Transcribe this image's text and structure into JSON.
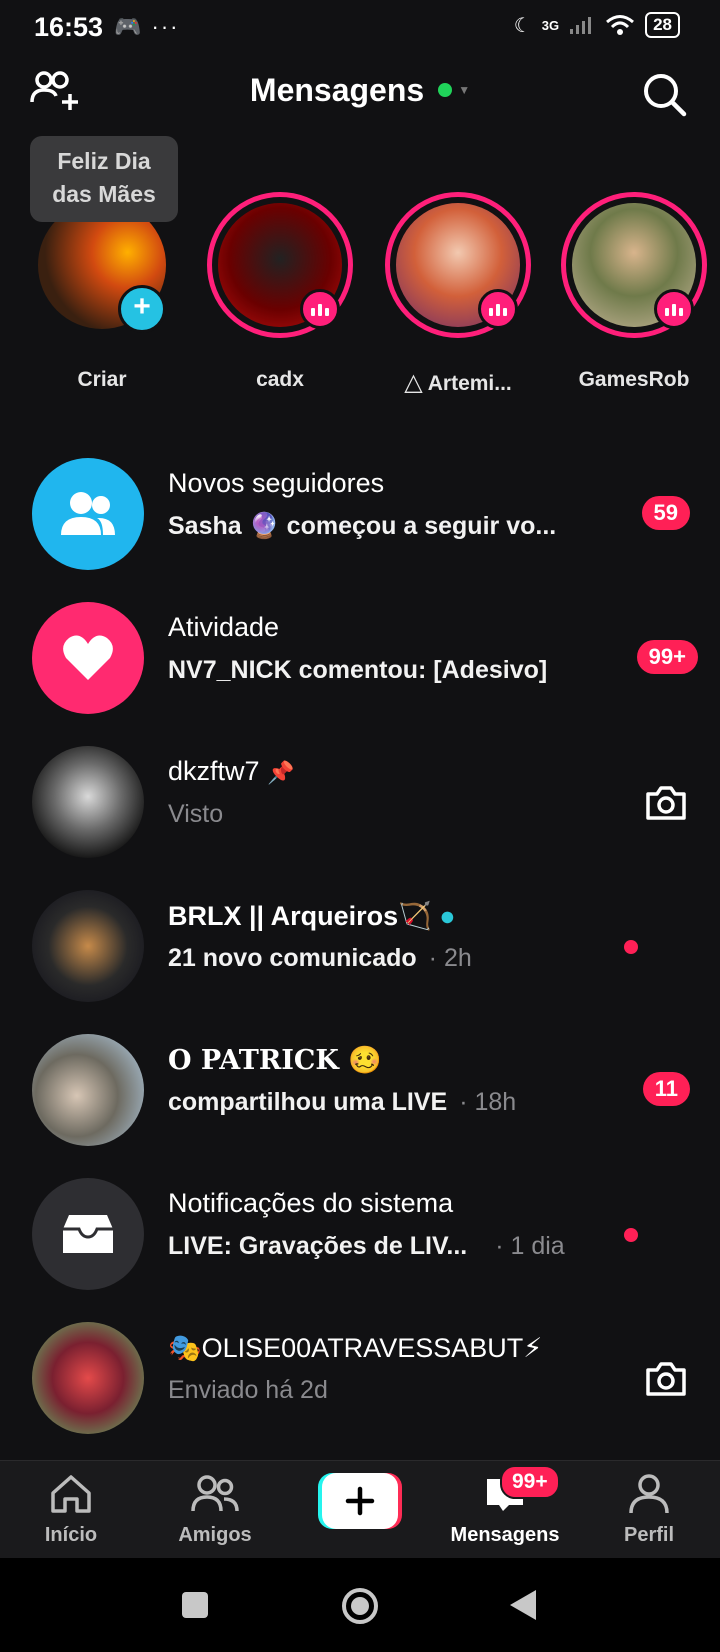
{
  "status": {
    "time": "16:53",
    "net": "3G",
    "battery": "28"
  },
  "header": {
    "title": "Mensagens"
  },
  "tooltip": {
    "line1": "Feliz Dia",
    "line2": "das Mães"
  },
  "stories": [
    {
      "name": "Criar"
    },
    {
      "name": "cadx"
    },
    {
      "name": "Artemi..."
    },
    {
      "name": "GamesRob"
    }
  ],
  "messages": [
    {
      "title": "Novos seguidores",
      "sub": "Sasha 🔮 começou a seguir vo...",
      "badge": "59"
    },
    {
      "title": "Atividade",
      "sub": "NV7_NICK comentou: [Adesivo]",
      "badge": "99+"
    },
    {
      "title": "dkzftw7",
      "sub": "Visto"
    },
    {
      "title": "BRLX || Arqueiros🏹",
      "sub": "21 novo comunicado",
      "time": "· 2h"
    },
    {
      "title": "O PATRICK 🥴",
      "sub": "compartilhou uma LIVE",
      "time": "· 18h",
      "badge": "11"
    },
    {
      "title": "Notificações do sistema",
      "sub": "LIVE: Gravações de LIV...",
      "time": "· 1 dia"
    },
    {
      "title": "🎭OLISE00ATRAVESSABUT⚡",
      "sub": "Enviado há 2d"
    }
  ],
  "nav": {
    "home": "Início",
    "friends": "Amigos",
    "messages": "Mensagens",
    "messages_badge": "99+",
    "profile": "Perfil"
  },
  "colors": {
    "accent": "#ff1f7a",
    "badge": "#ff2056",
    "cyan": "#25c2e3",
    "online": "#20d35a"
  }
}
